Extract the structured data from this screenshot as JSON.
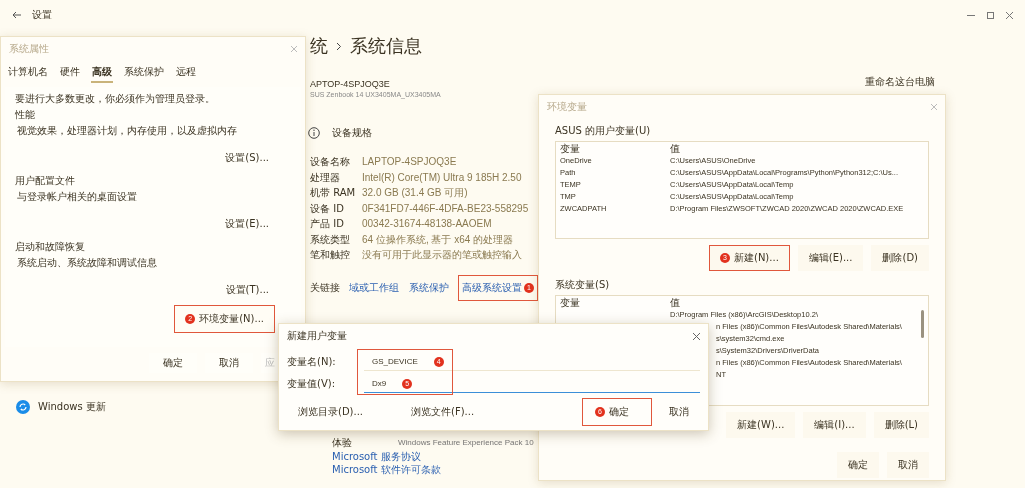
{
  "settings": {
    "title": "设置",
    "breadcrumb_parent": "统",
    "breadcrumb_current": "系统信息",
    "device_name": "APTOP-4SPJOQ3E",
    "device_model": "SUS Zenbook 14 UX3405MA_UX3405MA",
    "rename_link": "重命名这台电脑",
    "specs_title": "设备规格",
    "specs": [
      {
        "label": "设备名称",
        "value": "LAPTOP-4SPJOQ3E"
      },
      {
        "label": "处理器",
        "value": "Intel(R) Core(TM) Ultra 9 185H   2.50"
      },
      {
        "label": "机带 RAM",
        "value": "32.0 GB (31.4 GB 可用)"
      },
      {
        "label": "设备 ID",
        "value": "0F341FD7-446F-4DFA-BE23-558295"
      },
      {
        "label": "产品 ID",
        "value": "00342-31674-48138-AAOEM"
      },
      {
        "label": "系统类型",
        "value": "64 位操作系统, 基于 x64 的处理器"
      },
      {
        "label": "笔和触控",
        "value": "没有可用于此显示器的笔或触控输入"
      }
    ],
    "related_label": "关链接",
    "related_links": [
      {
        "label": "域或工作组",
        "highlighted": false
      },
      {
        "label": "系统保护",
        "highlighted": false
      },
      {
        "label": "高级系统设置",
        "highlighted": true,
        "badge": "1"
      }
    ],
    "experience": {
      "label": "体验",
      "value": "Windows Feature Experience Pack 10"
    },
    "legal_links": [
      "Microsoft 服务协议",
      "Microsoft 软件许可条款"
    ],
    "nav_items": [
      {
        "label": "Windows 更新"
      }
    ]
  },
  "system_properties": {
    "title": "系统属性",
    "tabs": [
      {
        "label": "计算机名",
        "selected": false
      },
      {
        "label": "硬件",
        "selected": false
      },
      {
        "label": "高级",
        "selected": true
      },
      {
        "label": "系统保护",
        "selected": false
      },
      {
        "label": "远程",
        "selected": false
      }
    ],
    "admin_note": "要进行大多数更改，你必须作为管理员登录。",
    "sections": [
      {
        "title": "性能",
        "description": "视觉效果，处理器计划，内存使用，以及虚拟内存",
        "button": "设置(S)..."
      },
      {
        "title": "用户配置文件",
        "description": "与登录帐户相关的桌面设置",
        "button": "设置(E)..."
      },
      {
        "title": "启动和故障恢复",
        "description": "系统启动、系统故障和调试信息",
        "button": "设置(T)..."
      }
    ],
    "env_button": {
      "label": "环境变量(N)...",
      "highlighted": true,
      "badge": "2"
    },
    "footer_buttons": [
      "确定",
      "取消",
      "应"
    ]
  },
  "environment_variables": {
    "title": "环境变量",
    "user_label": "ASUS 的用户变量(U)",
    "user_columns": [
      "变量",
      "值"
    ],
    "user_rows": [
      {
        "name": "OneDrive",
        "value": "C:\\Users\\ASUS\\OneDrive"
      },
      {
        "name": "Path",
        "value": "C:\\Users\\ASUS\\AppData\\Local\\Programs\\Python\\Python312;C:\\Us..."
      },
      {
        "name": "TEMP",
        "value": "C:\\Users\\ASUS\\AppData\\Local\\Temp"
      },
      {
        "name": "TMP",
        "value": "C:\\Users\\ASUS\\AppData\\Local\\Temp"
      },
      {
        "name": "ZWCADPATH",
        "value": "D:\\Program Files\\ZWSOFT\\ZWCAD 2020\\ZWCAD 2020\\ZWCAD.EXE"
      }
    ],
    "user_buttons": [
      {
        "label": "新建(N)...",
        "highlighted": true,
        "badge": "3"
      },
      {
        "label": "编辑(E)...",
        "highlighted": false
      },
      {
        "label": "删除(D)",
        "highlighted": false
      }
    ],
    "system_label": "系统变量(S)",
    "system_columns": [
      "变量",
      "值"
    ],
    "system_rows": [
      {
        "kind": "full",
        "value": "D:\\Program Files (x86)\\ArcGIS\\Desktop10.2\\"
      },
      {
        "kind": "cut",
        "value": "n Files (x86)\\Common Files\\Autodesk Shared\\Materials\\"
      },
      {
        "kind": "cut",
        "value": "s\\system32\\cmd.exe"
      },
      {
        "kind": "cut",
        "value": "s\\System32\\Drivers\\DriverData"
      },
      {
        "kind": "cut",
        "value": "n Files (x86)\\Common Files\\Autodesk Shared\\Materials\\"
      },
      {
        "kind": "cut",
        "value": "NT"
      }
    ],
    "system_buttons": [
      {
        "label": "新建(W)...",
        "highlighted": false
      },
      {
        "label": "编辑(I)...",
        "highlighted": false
      },
      {
        "label": "删除(L)",
        "highlighted": false
      }
    ],
    "footer_buttons": [
      "确定",
      "取消"
    ]
  },
  "new_user_variable": {
    "title": "新建用户变量",
    "highlighted": true,
    "fields": [
      {
        "label": "变量名(N):",
        "value": "GS_DEVICE",
        "badge": "4",
        "focused": false
      },
      {
        "label": "变量值(V):",
        "value": "Dx9",
        "badge": "5",
        "focused": true
      }
    ],
    "buttons": [
      {
        "label": "浏览目录(D)...",
        "highlighted": false
      },
      {
        "label": "浏览文件(F)...",
        "highlighted": false
      },
      {
        "label": "确定",
        "highlighted": true,
        "badge": "6"
      },
      {
        "label": "取消",
        "highlighted": false
      }
    ]
  }
}
